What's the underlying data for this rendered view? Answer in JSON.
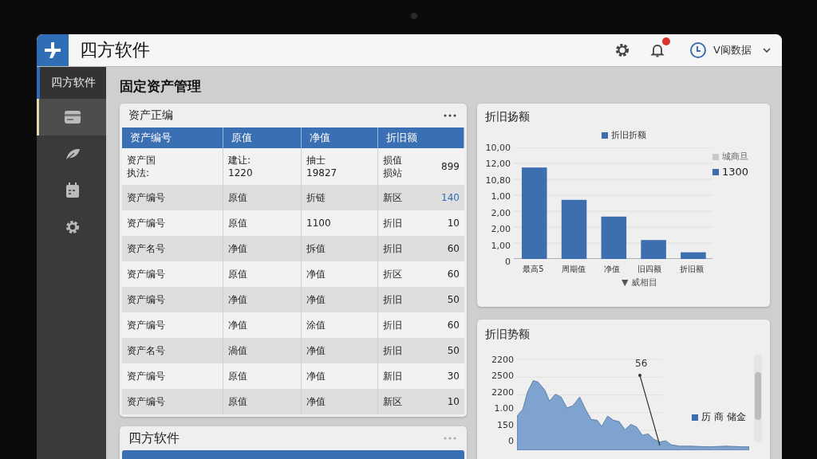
{
  "header": {
    "title": "四方软件",
    "user": "V阆数据"
  },
  "sidebar": {
    "brand": "四方软件",
    "items": [
      {
        "kind": "card",
        "selected": true
      },
      {
        "kind": "leaf",
        "selected": false
      },
      {
        "kind": "calendar",
        "selected": false
      },
      {
        "kind": "gear",
        "selected": false
      }
    ]
  },
  "page_title": "固定资产管理",
  "table_card": {
    "title": "资产正编",
    "columns": [
      "资产编号",
      "原值",
      "净值",
      "折旧额"
    ],
    "rows": [
      {
        "cells": [
          [
            "资产国",
            "执法:"
          ],
          [
            "建让:",
            "1220"
          ],
          [
            "抽士",
            "19827"
          ],
          [
            "损值",
            "损站"
          ]
        ],
        "amount": "899",
        "flagged": false
      },
      {
        "cells": [
          "资产编号",
          "原值",
          "折链",
          "新区"
        ],
        "amount": "140",
        "flagged": true
      },
      {
        "cells": [
          "资产编号",
          "原值",
          "1100",
          "折旧"
        ],
        "amount": "10",
        "flagged": false
      },
      {
        "cells": [
          "资产名号",
          "净值",
          "拆值",
          "折旧"
        ],
        "amount": "60",
        "flagged": false
      },
      {
        "cells": [
          "资产编号",
          "原值",
          "净值",
          "折区"
        ],
        "amount": "60",
        "flagged": false
      },
      {
        "cells": [
          "资产编号",
          "净值",
          "净值",
          "折旧"
        ],
        "amount": "50",
        "flagged": false
      },
      {
        "cells": [
          "资产编号",
          "净值",
          "涂值",
          "折旧"
        ],
        "amount": "60",
        "flagged": false
      },
      {
        "cells": [
          "资产名号",
          "渦值",
          "净值",
          "折旧"
        ],
        "amount": "50",
        "flagged": false
      },
      {
        "cells": [
          "资产编号",
          "原值",
          "净值",
          "新旧"
        ],
        "amount": "30",
        "flagged": false
      },
      {
        "cells": [
          "资产编号",
          "原值",
          "净值",
          "新区"
        ],
        "amount": "10",
        "flagged": false
      }
    ]
  },
  "bottom_card": {
    "title": "四方软件"
  },
  "bar_card": {
    "title": "折旧扬额",
    "legend": "折旧折额",
    "y_labels": [
      "10,00",
      "12,00",
      "10,80",
      "1,00",
      "2,00",
      "2,00",
      "1,00",
      "0"
    ],
    "x_labels": [
      "最高5",
      "周期值",
      "净值",
      "旧四额",
      "折旧额"
    ],
    "side_legend": [
      {
        "label": "城商旦",
        "color": "#c8c8c8"
      },
      {
        "label": "1300",
        "color": "#3d6fb0"
      }
    ],
    "footer": "▼ 威相目"
  },
  "area_card": {
    "title": "折旧势额",
    "y_labels": [
      "2200",
      "2500",
      "2200",
      "1.00",
      "150",
      "0"
    ],
    "annotation": "56",
    "legend": "历 商 储金"
  }
}
